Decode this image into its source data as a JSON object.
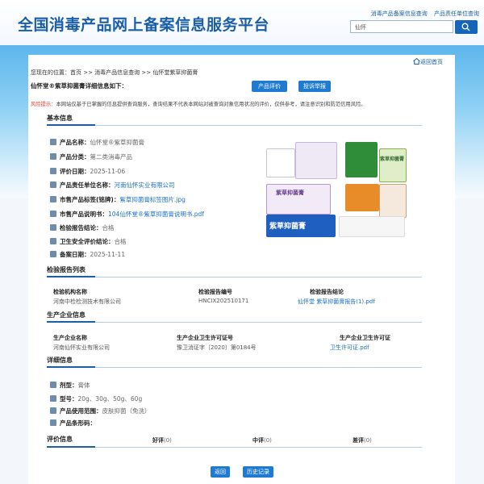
{
  "header": {
    "site_title": "全国消毒产品网上备案信息服务平台",
    "link_product_query": "消毒产品备案信息查询",
    "link_unit_query": "产品责任单位查询",
    "search_value": "仙怀"
  },
  "breadcrumb": {
    "text": "您现在的位置：首页 >> 消毒产品信息查询 >> 仙怀堂紫草抑菌膏",
    "return_home": "返回首页"
  },
  "detail_title": "仙怀堂®紫草抑菌膏详细信息如下：",
  "buttons": {
    "product_eval": "产品评价",
    "complaint": "投诉举报",
    "back": "返回",
    "history": "历史记录"
  },
  "risk": {
    "label": "风险提示：",
    "text": "本网站仅基于已掌握的信息提供查询服务，查询结果不代表本网站对被查询对象信用状况的评价，仅供参考，请注意识别和防范信用风险。"
  },
  "basic": {
    "title": "基本信息",
    "fields": [
      {
        "label": "产品名称：",
        "value": "仙怀堂®紫草抑菌膏"
      },
      {
        "label": "产品分类：",
        "value": "第二类消毒产品"
      },
      {
        "label": "评价日期：",
        "value": "2025-11-06"
      },
      {
        "label": "产品责任单位名称：",
        "value": "河南仙怀实业有限公司"
      },
      {
        "label": "市售产品标签(铭牌)：",
        "value": "紫草抑菌膏标签图片.jpg"
      },
      {
        "label": "市售产品说明书：",
        "value": "104仙怀堂®紫草抑菌膏说明书.pdf"
      },
      {
        "label": "检验报告结论：",
        "value": "合格"
      },
      {
        "label": "卫生安全评价结论：",
        "value": "合格"
      },
      {
        "label": "备案日期：",
        "value": "2025-11-11"
      }
    ]
  },
  "package_labels": {
    "purple_box": "紫草抑菌膏",
    "green_box": "紫草抑菌膏",
    "blue_tube": "紫草抑菌膏"
  },
  "inspection": {
    "title": "检验报告列表",
    "headers": [
      "检验机构名称",
      "检验报告编号",
      "检验报告结论"
    ],
    "row": [
      "河南中检检测技术有限公司",
      "HNCIX202510171",
      "仙怀堂 紫草抑菌膏报告(1).pdf"
    ]
  },
  "manufacturer": {
    "title": "生产企业信息",
    "headers": [
      "生产企业名称",
      "生产企业卫生许可证号",
      "生产企业卫生许可证"
    ],
    "row": [
      "河南仙怀实业有限公司",
      "豫卫消证字〔2020〕第0184号",
      "卫生许可证.pdf"
    ]
  },
  "details": {
    "title": "详细信息",
    "fields": [
      {
        "label": "剂型：",
        "value": "膏体"
      },
      {
        "label": "型号：",
        "value": "20g、30g、50g、60g"
      },
      {
        "label": "产品使用范围：",
        "value": "皮肤抑菌（免洗）"
      },
      {
        "label": "产品条形码：",
        "value": ""
      }
    ]
  },
  "evaluation": {
    "title": "评价信息",
    "good_label": "好评",
    "good_count": "(0)",
    "mid_label": "中评",
    "mid_count": "(0)",
    "bad_label": "差评",
    "bad_count": "(0)"
  },
  "colors": {
    "brand_blue": "#1a5fa8",
    "button_blue": "#1f7bd2",
    "link_blue": "#1a6fc8",
    "risk_red": "#e23a2e"
  }
}
